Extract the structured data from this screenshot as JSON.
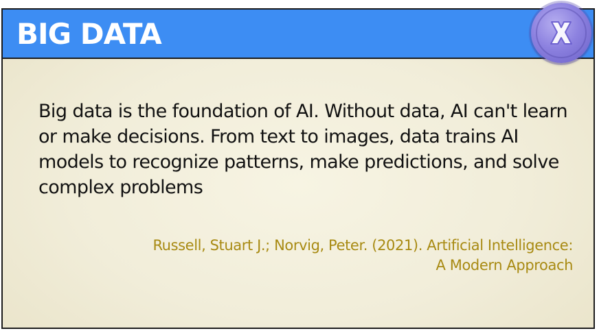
{
  "card": {
    "title": "BIG DATA",
    "body": "Big data is the foundation of AI. Without data, AI can't learn or make decisions. From text to images, data trains AI models to recognize patterns, make predictions, and solve complex problems",
    "citation_line1": "Russell, Stuart J.; Norvig, Peter. (2021). Artificial Intelligence:",
    "citation_line2": "A Modern Approach"
  },
  "close_button": {
    "icon": "close-icon",
    "color": "#8d82e0"
  },
  "colors": {
    "header": "#3d8df3",
    "citation": "#a88a12",
    "background": "#f1edd9"
  }
}
